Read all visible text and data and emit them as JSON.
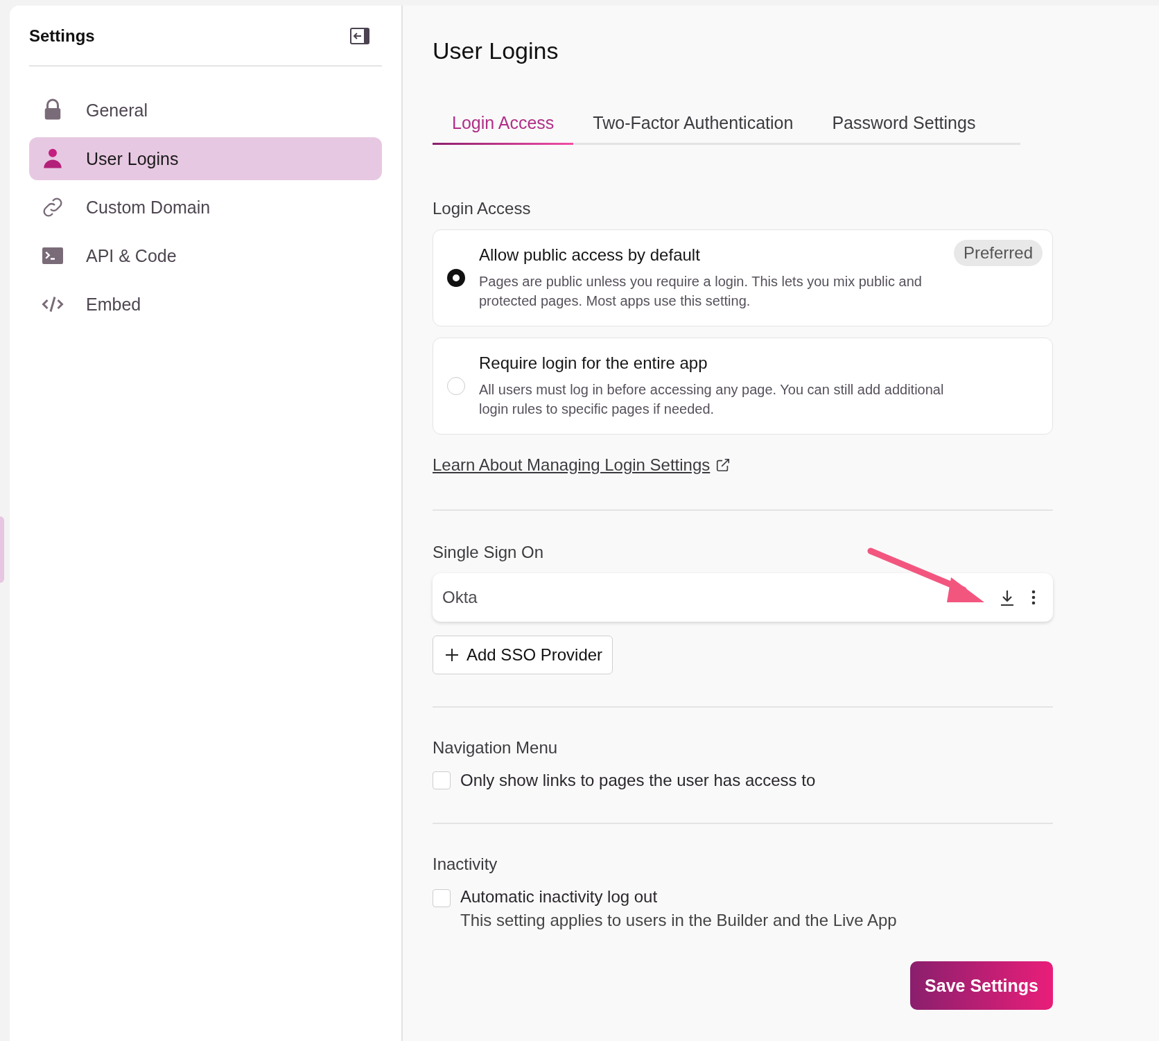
{
  "sidebar": {
    "title": "Settings",
    "items": [
      {
        "label": "General",
        "selected": false
      },
      {
        "label": "User Logins",
        "selected": true
      },
      {
        "label": "Custom Domain",
        "selected": false
      },
      {
        "label": "API & Code",
        "selected": false
      },
      {
        "label": "Embed",
        "selected": false
      }
    ]
  },
  "page_title": "User Logins",
  "tabs": [
    {
      "label": "Login Access",
      "selected": true
    },
    {
      "label": "Two-Factor Authentication",
      "selected": false
    },
    {
      "label": "Password Settings",
      "selected": false
    }
  ],
  "login_access": {
    "heading": "Login Access",
    "options": [
      {
        "title": "Allow public access by default",
        "description": "Pages are public unless you require a login. This lets you mix public and protected pages. Most apps use this setting.",
        "badge": "Preferred",
        "selected": true
      },
      {
        "title": "Require login for the entire app",
        "description": "All users must log in before accessing any page. You can still add additional login rules to specific pages if needed.",
        "selected": false
      }
    ],
    "link": "Learn About Managing Login Settings"
  },
  "single_sign_on": {
    "heading": "Single Sign On",
    "providers": [
      "Okta"
    ],
    "add_button": "Add SSO Provider"
  },
  "navigation_menu": {
    "heading": "Navigation Menu",
    "checkbox": {
      "label": "Only show links to pages the user has access to",
      "checked": false
    }
  },
  "inactivity": {
    "heading": "Inactivity",
    "checkbox": {
      "label": "Automatic inactivity log out",
      "hint": "This setting applies to users in the Builder and the Live App",
      "checked": false
    }
  },
  "save_button": "Save Settings"
}
